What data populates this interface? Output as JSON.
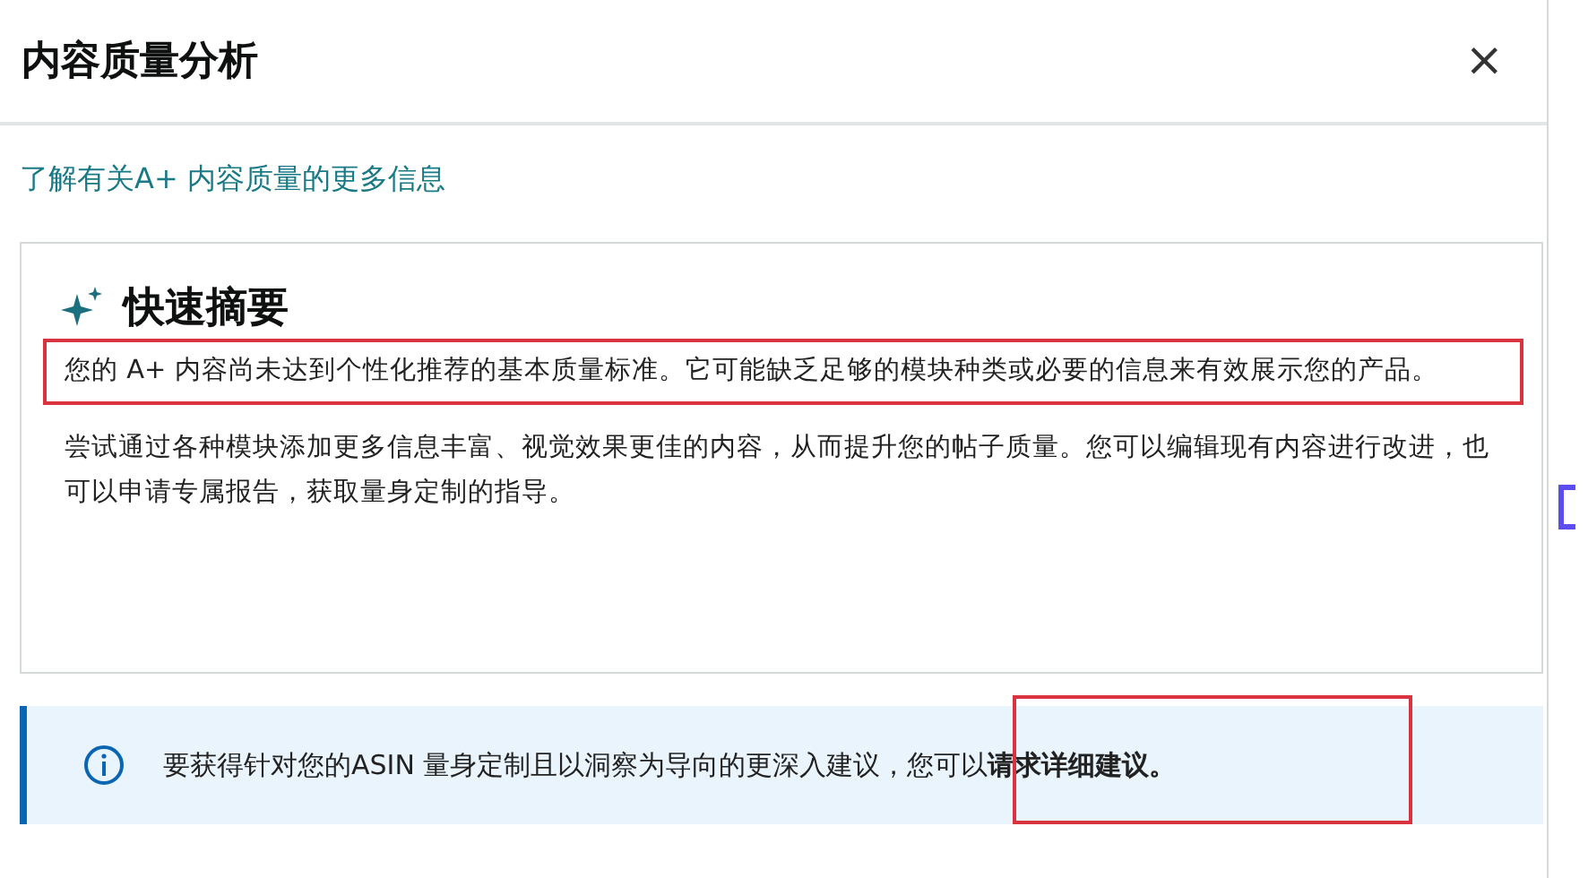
{
  "dialog": {
    "title": "内容质量分析",
    "close": "×"
  },
  "learn_more_link": "了解有关A+ 内容质量的更多信息",
  "summary_card": {
    "title": "快速摘要",
    "paragraphs": [
      {
        "text": "您的 A+ 内容尚未达到个性化推荐的基本质量标准。它可能缺乏足够的模块种类或必要的信息来有效展示您的产品。",
        "highlighted": true
      },
      {
        "text": "尝试通过各种模块添加更多信息丰富、视觉效果更佳的内容，从而提升您的帖子质量。您可以编辑现有内容进行改进，也可以申请专属报告，获取量身定制的指导。",
        "highlighted": false
      }
    ]
  },
  "info_banner": {
    "text": "要获得针对您的ASIN 量身定制且以洞察为导向的更深入建议，您可以**请求详细建议。**",
    "highlighted": true
  }
}
